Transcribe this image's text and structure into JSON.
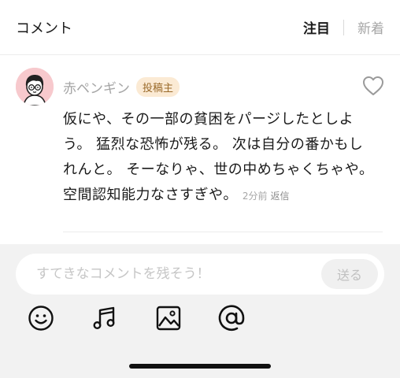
{
  "header": {
    "title": "コメント",
    "sort_popular": "注目",
    "sort_newest": "新着"
  },
  "comment": {
    "author": "赤ペンギン",
    "badge": "投稿主",
    "text": "仮にや、その一部の貧困をパージしたとしよう。 猛烈な恐怖が残る。 次は自分の番かもしれんと。 そーなりゃ、世の中めちゃくちゃや。 空間認知能力なさすぎや。",
    "time": "2分前",
    "reply_label": "返信",
    "liked": false
  },
  "composer": {
    "placeholder": "すてきなコメントを残そう！",
    "value": "",
    "send_label": "送る",
    "tools": [
      "emoji-icon",
      "music-icon",
      "image-icon",
      "mention-icon"
    ]
  },
  "colors": {
    "avatar_bg": "#f7c9cd",
    "badge_bg": "#fbead4",
    "composer_bg": "#f2f2f2"
  }
}
